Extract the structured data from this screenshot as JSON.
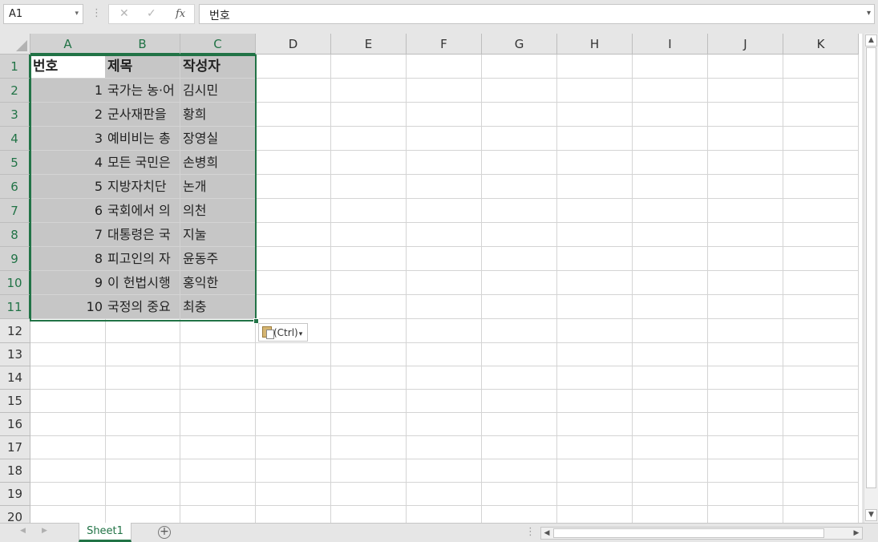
{
  "formula_bar": {
    "name_box": "A1",
    "cancel_icon": "✕",
    "enter_icon": "✓",
    "fx_label": "fx",
    "formula_value": "번호"
  },
  "columns": [
    "A",
    "B",
    "C",
    "D",
    "E",
    "F",
    "G",
    "H",
    "I",
    "J",
    "K"
  ],
  "rows": [
    "1",
    "2",
    "3",
    "4",
    "5",
    "6",
    "7",
    "8",
    "9",
    "10",
    "11",
    "12",
    "13",
    "14",
    "15",
    "16",
    "17",
    "18",
    "19",
    "20"
  ],
  "cells": [
    [
      "번호",
      "제목",
      "작성자"
    ],
    [
      "1",
      "국가는 농·어",
      "김시민"
    ],
    [
      "2",
      "군사재판을",
      "황희"
    ],
    [
      "3",
      "예비비는 총",
      "장영실"
    ],
    [
      "4",
      "모든 국민은",
      "손병희"
    ],
    [
      "5",
      "지방자치단",
      "논개"
    ],
    [
      "6",
      "국회에서 의",
      "의천"
    ],
    [
      "7",
      "대통령은 국",
      "지눌"
    ],
    [
      "8",
      "피고인의 자",
      "윤동주"
    ],
    [
      "9",
      "이 헌법시행",
      "홍익한"
    ],
    [
      "10",
      "국정의 중요",
      "최충"
    ]
  ],
  "paste_options": {
    "label": "(Ctrl)",
    "arrow": "▾"
  },
  "sheet_tabs": [
    {
      "label": "Sheet1",
      "active": true
    }
  ],
  "add_sheet": "+",
  "icons": {
    "dropdown": "▾",
    "scroll_up": "▲",
    "scroll_down": "▼",
    "scroll_left": "◀",
    "scroll_right": "▶"
  },
  "colors": {
    "accent": "#217346",
    "selection": "#c6c6c6"
  }
}
